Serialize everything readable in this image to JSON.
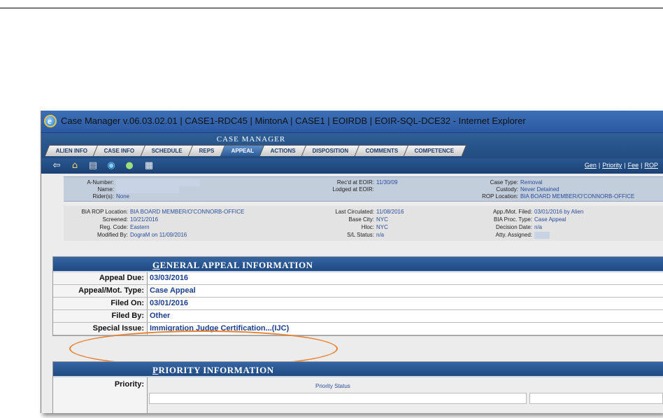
{
  "window": {
    "title": "Case Manager v.06.03.02.01 | CASE1-RDC45 | MintonA | CASE1 | EOIRDB | EOIR-SQL-DCE32 - Internet Explorer"
  },
  "app": {
    "header_title": "CASE MANAGER",
    "tabs": [
      {
        "label": "ALIEN INFO",
        "active": false
      },
      {
        "label": "CASE INFO",
        "active": false
      },
      {
        "label": "SCHEDULE",
        "active": false
      },
      {
        "label": "REPS",
        "active": false
      },
      {
        "label": "APPEAL",
        "active": true
      },
      {
        "label": "ACTIONS",
        "active": false
      },
      {
        "label": "DISPOSITION",
        "active": false
      },
      {
        "label": "COMMENTS",
        "active": false
      },
      {
        "label": "COMPETENCE",
        "active": false
      }
    ],
    "toolbar_links": [
      "Gen",
      "Priority",
      "Fee",
      "ROP"
    ]
  },
  "case_summary": {
    "a_number_label": "A-Number:",
    "name_label": "Name:",
    "riders_label": "Rider(s):",
    "riders_value": "None",
    "recd_label": "Rec'd at EOIR:",
    "recd_value": "11/30/09",
    "lodged_label": "Lodged at EOIR:",
    "lodged_value": "",
    "case_type_label": "Case Type:",
    "case_type_value": "Removal",
    "custody_label": "Custody:",
    "custody_value": "Never Detained",
    "rop_location_label": "ROP Location:",
    "rop_location_value": "BIA BOARD MEMBER/O'CONNORB-OFFICE"
  },
  "bia_info": {
    "bia_rop_label": "BIA ROP Location:",
    "bia_rop_value": "BIA BOARD MEMBER/O'CONNORB-OFFICE",
    "screened_label": "Screened:",
    "screened_value": "10/21/2016",
    "reg_code_label": "Reg. Code:",
    "reg_code_value": "Eastern",
    "modified_label": "Modified By:",
    "modified_value": "DograM on 11/09/2016",
    "last_circ_label": "Last Circulated:",
    "last_circ_value": "11/08/2016",
    "base_city_label": "Base City:",
    "base_city_value": "NYC",
    "hloc_label": "Hloc:",
    "hloc_value": "NYC",
    "sl_status_label": "S/L Status:",
    "sl_status_value": "n/a",
    "app_filed_label": "App./Mot. Filed:",
    "app_filed_value": "03/01/2016 by Alien",
    "proc_type_label": "BIA Proc. Type:",
    "proc_type_value": "Case Appeal",
    "decision_label": "Decision Date:",
    "decision_value": "n/a",
    "atty_label": "Atty. Assigned:"
  },
  "general_appeal": {
    "heading_first": "G",
    "heading_rest": "ENERAL APPEAL INFORMATION",
    "rows": [
      {
        "label": "Appeal Due:",
        "value": "03/03/2016"
      },
      {
        "label": "Appeal/Mot. Type:",
        "value": "Case Appeal"
      },
      {
        "label": "Filed On:",
        "value": "03/01/2016"
      },
      {
        "label": "Filed By:",
        "value": "Other"
      },
      {
        "label": "Special Issue:",
        "value": "Immigration Judge Certification...(IJC)"
      }
    ]
  },
  "priority": {
    "heading_first": "P",
    "heading_rest": "RIORITY INFORMATION",
    "label": "Priority:",
    "status_header": "Priority Status"
  },
  "colors": {
    "accent": "#1f4a82",
    "highlight_oval": "#e8812c",
    "value_text": "#1b3f8e"
  }
}
